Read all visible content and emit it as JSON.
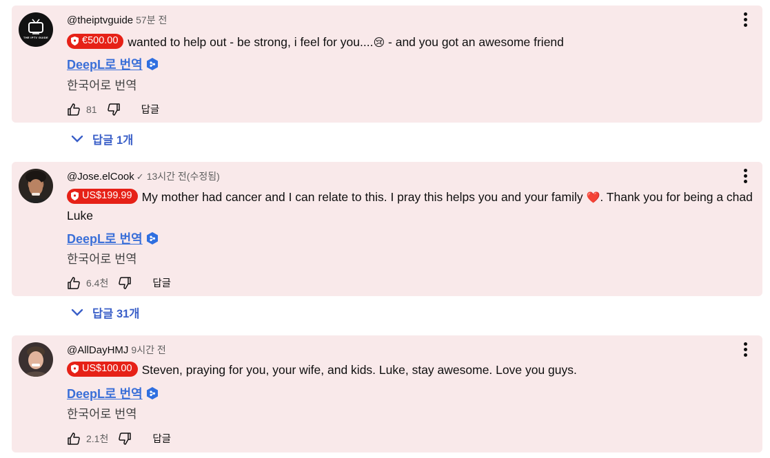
{
  "comments": [
    {
      "author": "@theiptvguide",
      "verified": false,
      "time": "57분 전",
      "amount": "€500.00",
      "text_before": "wanted to help out - be strong, i feel for you....",
      "emoji": "😢",
      "text_after": " - and you got an awesome friend",
      "deepl_label": "DeepL로 번역",
      "translate_label": "한국어로 번역",
      "likes": "81",
      "reply_label": "답글",
      "avatar_text": "THE IPTV GUIDE",
      "replies_label": "답글 1개"
    },
    {
      "author": "@Jose.elCook",
      "verified": true,
      "time": "13시간 전(수정됨)",
      "amount": "US$199.99",
      "text_before": "My mother had cancer and I can relate to this. I pray this helps you and your family ",
      "emoji": "❤️",
      "text_after": ". Thank you for being a chad Luke",
      "deepl_label": "DeepL로 번역",
      "translate_label": "한국어로 번역",
      "likes": "6.4천",
      "reply_label": "답글",
      "replies_label": "답글 31개"
    },
    {
      "author": "@AllDayHMJ",
      "verified": false,
      "time": "9시간 전",
      "amount": "US$100.00",
      "text_before": "Steven, praying for you, your wife, and kids. Luke, stay awesome. Love you guys.",
      "emoji": "",
      "text_after": "",
      "deepl_label": "DeepL로 번역",
      "translate_label": "한국어로 번역",
      "likes": "2.1천",
      "reply_label": "답글"
    }
  ],
  "colors": {
    "card_bg": "#f9e9ea",
    "badge_red": "#e62117",
    "link_blue": "#3a6fd8",
    "replies_blue": "#3a5fc8"
  }
}
